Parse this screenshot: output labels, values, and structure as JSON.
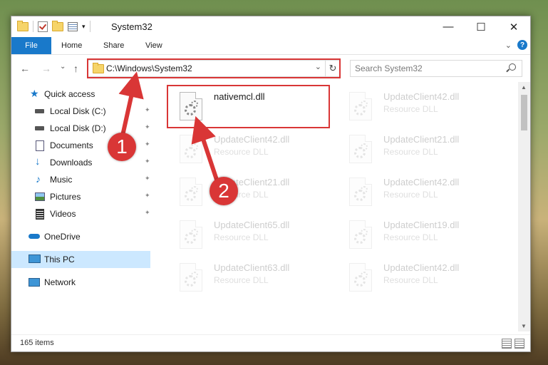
{
  "window": {
    "title": "System32",
    "controls": {
      "minimize": "—",
      "maximize": "☐",
      "close": "✕"
    }
  },
  "ribbon": {
    "tabs": [
      "File",
      "Home",
      "Share",
      "View"
    ],
    "expand_glyph": "⌄",
    "help": "?"
  },
  "navigation": {
    "back": "←",
    "forward": "→",
    "recent": "⌄",
    "up": "↑",
    "address": "C:\\Windows\\System32",
    "address_dropdown": "⌄",
    "refresh": "↻",
    "search_placeholder": "Search System32"
  },
  "sidebar": {
    "items": [
      {
        "label": "Quick access",
        "icon": "star-icon",
        "pinned": false
      },
      {
        "label": "Local Disk (C:)",
        "icon": "drive-icon",
        "pinned": true
      },
      {
        "label": "Local Disk (D:)",
        "icon": "drive-icon",
        "pinned": true
      },
      {
        "label": "Documents",
        "icon": "documents-icon",
        "pinned": true
      },
      {
        "label": "Downloads",
        "icon": "download-arrow-icon",
        "pinned": true
      },
      {
        "label": "Music",
        "icon": "music-note-icon",
        "pinned": true
      },
      {
        "label": "Pictures",
        "icon": "pictures-icon",
        "pinned": true
      },
      {
        "label": "Videos",
        "icon": "film-icon",
        "pinned": true
      },
      {
        "label": "OneDrive",
        "icon": "cloud-icon",
        "pinned": false
      },
      {
        "label": "This PC",
        "icon": "monitor-icon",
        "pinned": false,
        "selected": true
      },
      {
        "label": "Network",
        "icon": "network-icon",
        "pinned": false
      }
    ]
  },
  "files": [
    {
      "name": "nativemcl.dll",
      "type": "",
      "highlighted": true
    },
    {
      "name": "UpdateClient42.dll",
      "type": "Resource DLL"
    },
    {
      "name": "UpdateClient42.dll",
      "type": "Resource DLL"
    },
    {
      "name": "UpdateClient21.dll",
      "type": "Resource DLL"
    },
    {
      "name": "UpdateClient21.dll",
      "type": "Resource DLL"
    },
    {
      "name": "UpdateClient42.dll",
      "type": "Resource DLL"
    },
    {
      "name": "UpdateClient65.dll",
      "type": "Resource DLL"
    },
    {
      "name": "UpdateClient19.dll",
      "type": "Resource DLL"
    },
    {
      "name": "UpdateClient63.dll",
      "type": "Resource DLL"
    },
    {
      "name": "UpdateClient42.dll",
      "type": "Resource DLL"
    }
  ],
  "status": {
    "item_count": "165 items"
  },
  "annotations": {
    "step1": "1",
    "step2": "2",
    "color": "#d93636"
  }
}
